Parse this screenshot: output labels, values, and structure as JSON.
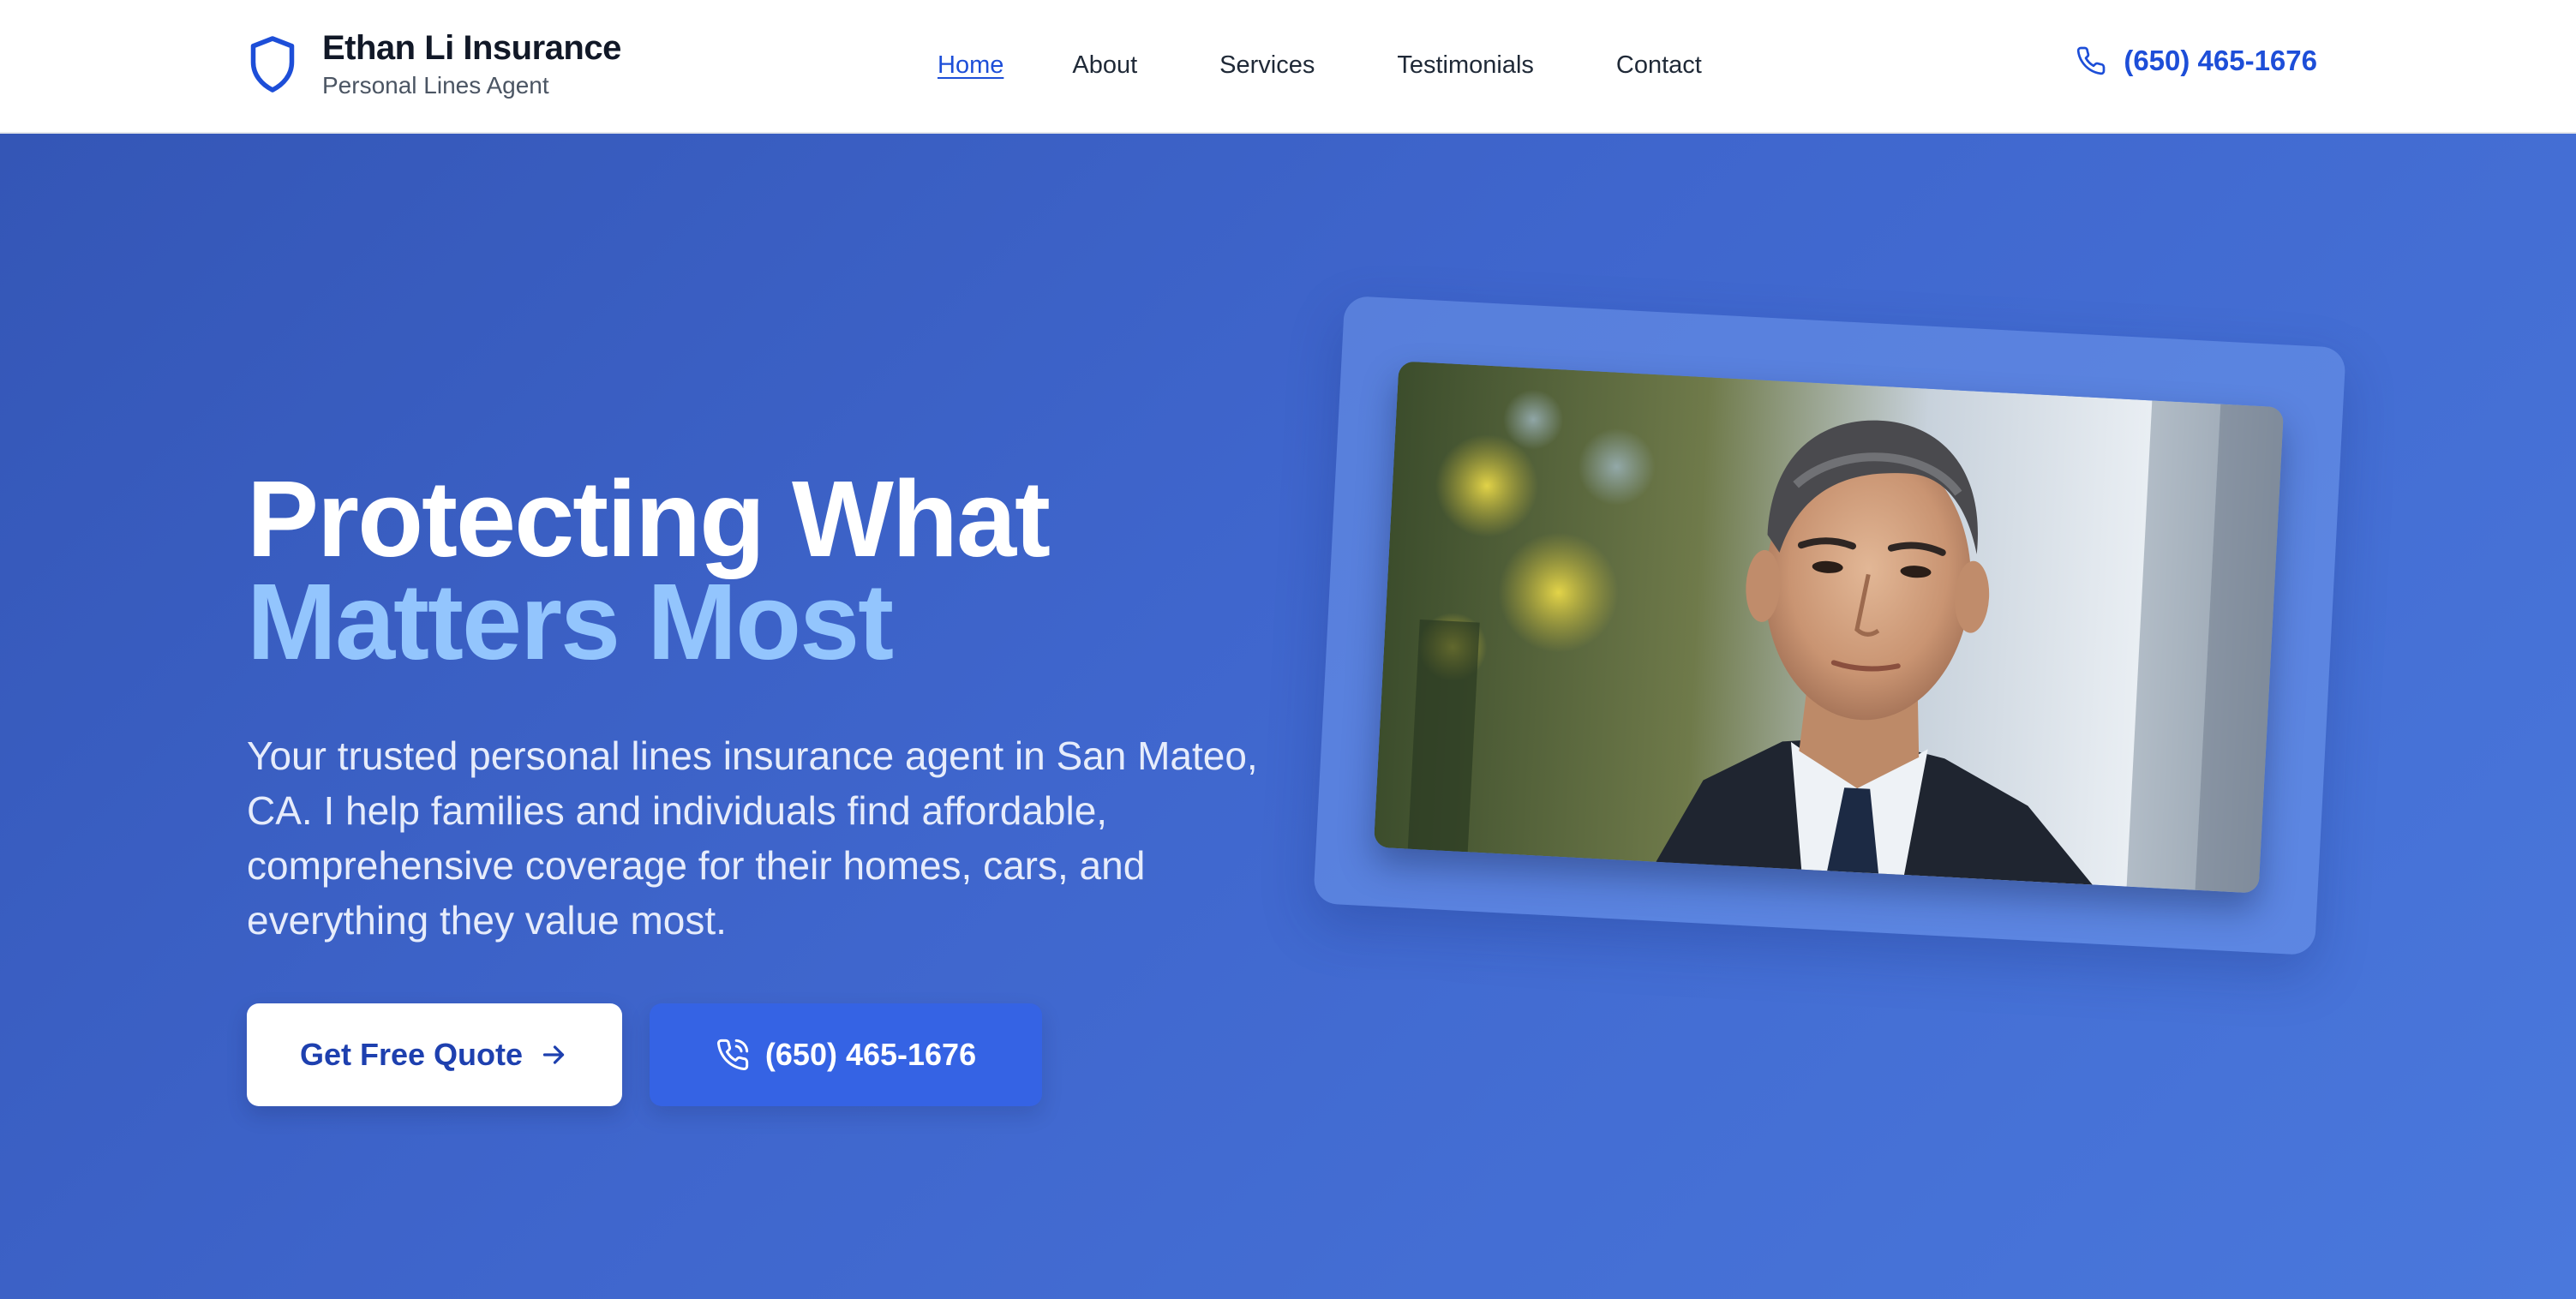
{
  "header": {
    "brand_name": "Ethan Li Insurance",
    "brand_sub": "Personal Lines Agent",
    "brand_icon": "shield-icon",
    "nav": [
      {
        "label": "Home",
        "active": true
      },
      {
        "label": "About",
        "active": false
      },
      {
        "label": "Services",
        "active": false
      },
      {
        "label": "Testimonials",
        "active": false
      },
      {
        "label": "Contact",
        "active": false
      }
    ],
    "phone": "(650) 465-1676",
    "phone_icon": "phone-icon"
  },
  "hero": {
    "headline_line1": "Protecting What",
    "headline_line2": "Matters Most",
    "lead": "Your trusted personal lines insurance agent in San Mateo, CA. I help families and individuals find affordable, comprehensive coverage for their homes, cars, and everything they value most.",
    "cta_primary": "Get Free Quote",
    "cta_primary_icon": "arrow-right-icon",
    "cta_secondary": "(650) 465-1676",
    "cta_secondary_icon": "phone-call-icon",
    "portrait": "agent-portrait"
  },
  "colors": {
    "accent": "#1d4ed8",
    "hero_start": "#3456b6",
    "hero_end": "#4a78dc",
    "headline_highlight": "#93c5fd",
    "call_button": "#3563e4"
  }
}
